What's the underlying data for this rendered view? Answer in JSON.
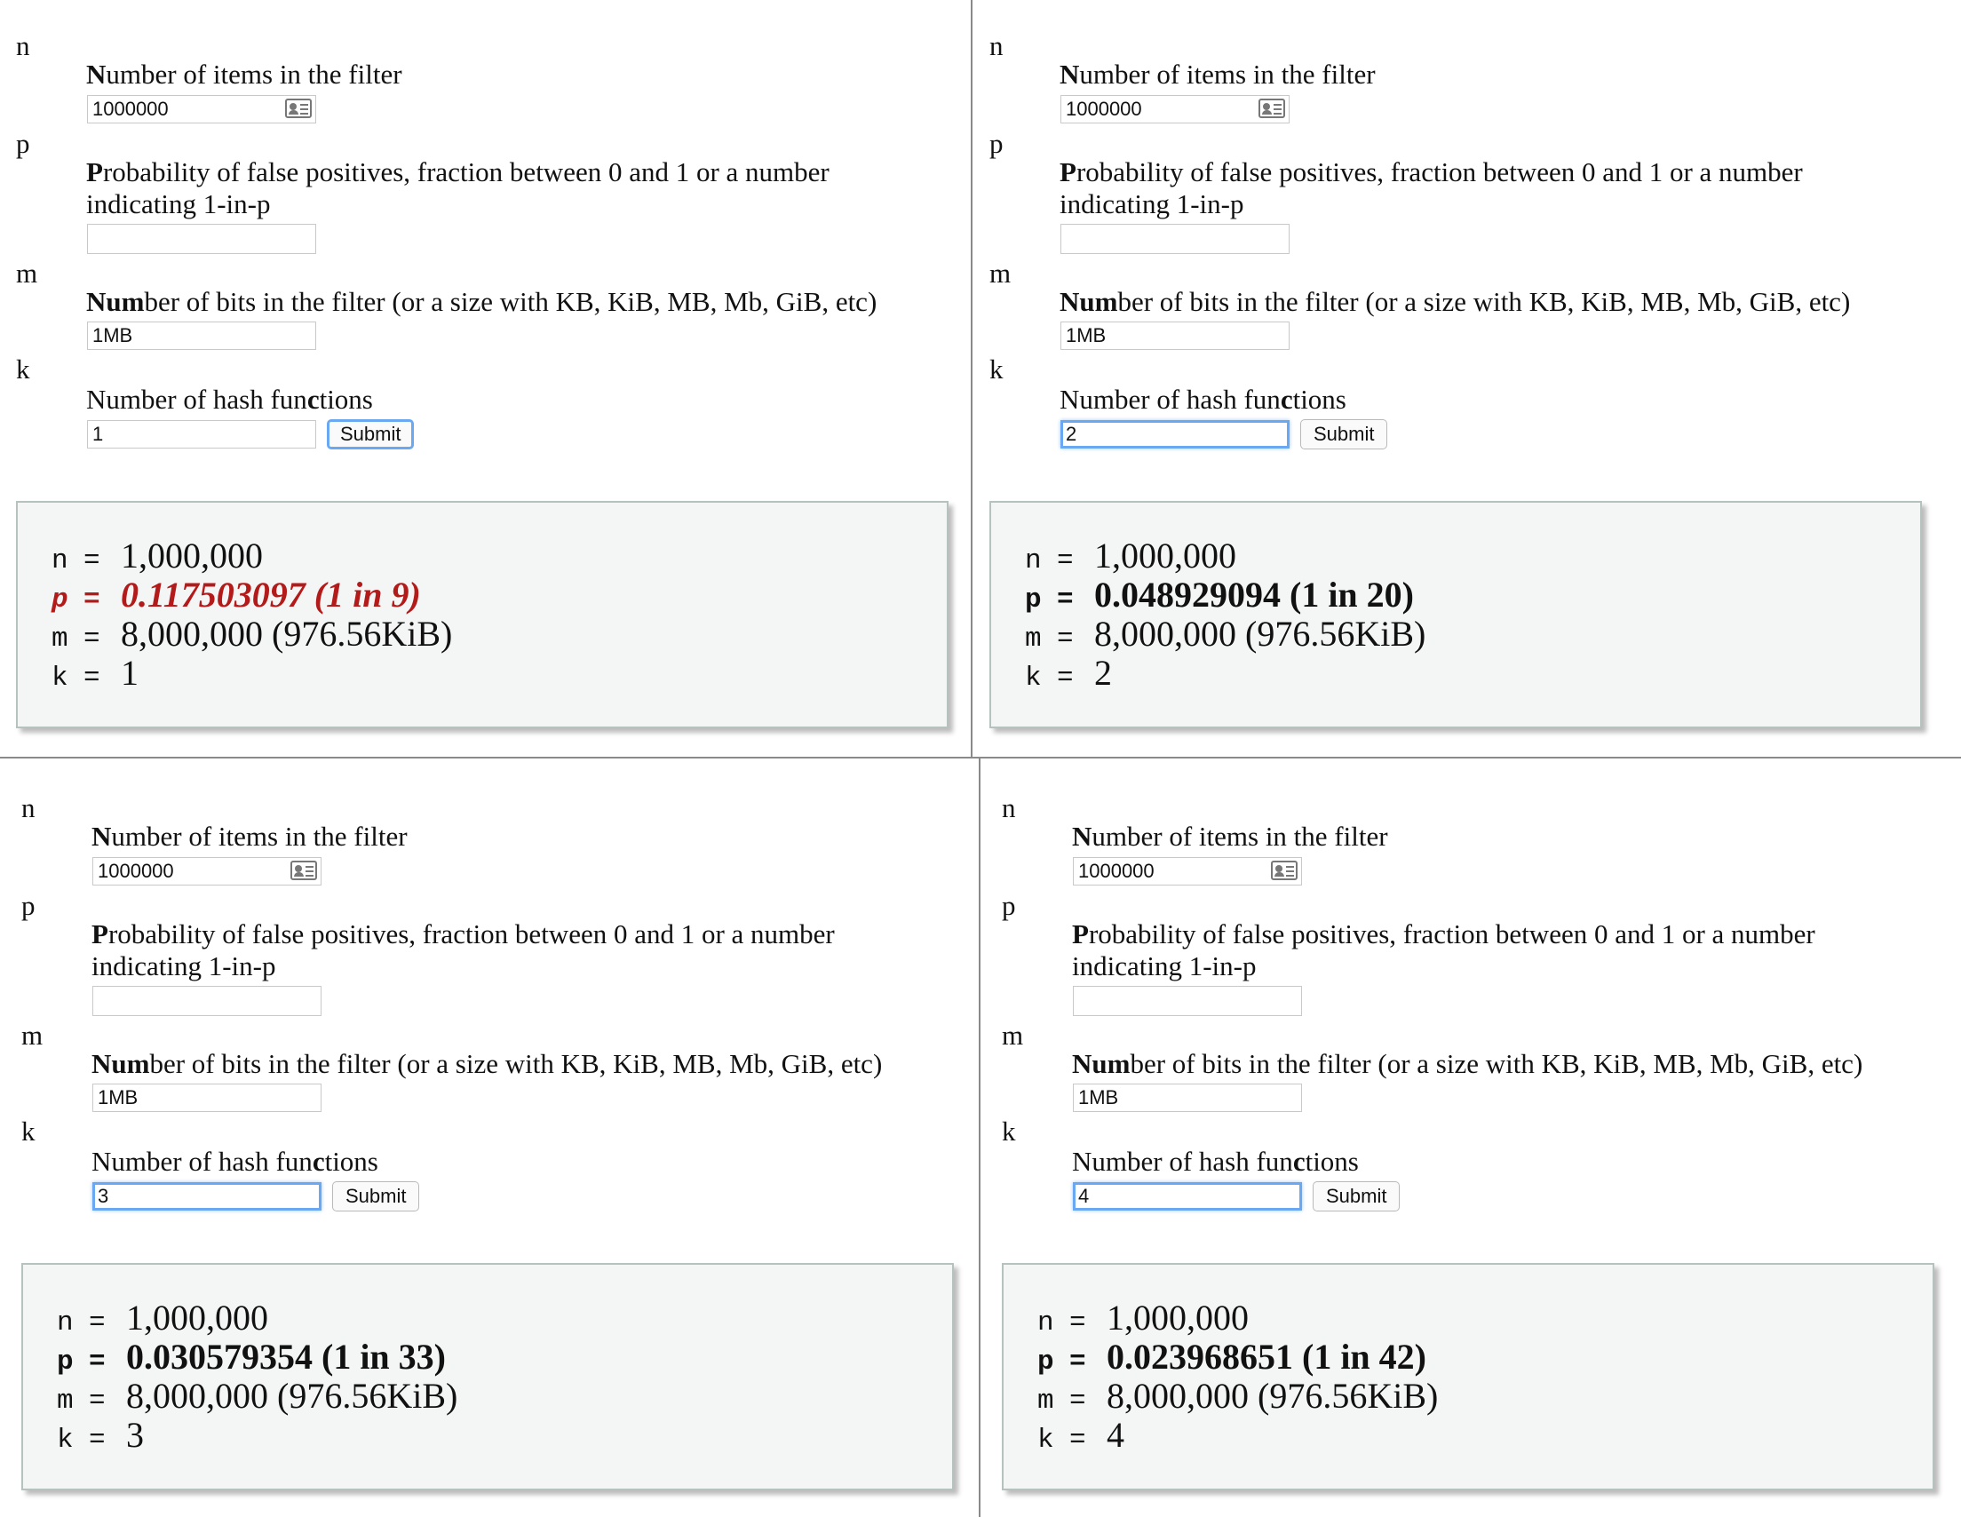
{
  "form": {
    "n_letter": "n",
    "p_letter": "p",
    "m_letter": "m",
    "k_letter": "k",
    "n_label_lead": "N",
    "n_label": "umber of items in the filter",
    "p_label_lead": "P",
    "p_label": "robability of false positives, fraction between 0 and 1 or a number indicating 1-in-p",
    "m_label_lead": "Num",
    "m_label": "ber of bits in the filter (or a size with KB, KiB, MB, Mb, GiB, etc)",
    "k_label_pre": "Number of hash fun",
    "k_label_lead": "c",
    "k_label": "tions",
    "submit_label": "Submit"
  },
  "panels": [
    {
      "n_value": "1000000",
      "p_value": "",
      "m_value": "1MB",
      "k_value": "1",
      "k_focused": false,
      "submit_focused": true,
      "p_error": true,
      "result": {
        "n": "1,000,000",
        "p": "0.117503097 (1 in 9)",
        "m": "8,000,000 (976.56KiB)",
        "k": "1"
      }
    },
    {
      "n_value": "1000000",
      "p_value": "",
      "m_value": "1MB",
      "k_value": "2",
      "k_focused": true,
      "submit_focused": false,
      "p_error": false,
      "result": {
        "n": "1,000,000",
        "p": "0.048929094 (1 in 20)",
        "m": "8,000,000 (976.56KiB)",
        "k": "2"
      }
    },
    {
      "n_value": "1000000",
      "p_value": "",
      "m_value": "1MB",
      "k_value": "3",
      "k_focused": true,
      "submit_focused": false,
      "p_error": false,
      "result": {
        "n": "1,000,000",
        "p": "0.030579354 (1 in 33)",
        "m": "8,000,000 (976.56KiB)",
        "k": "3"
      }
    },
    {
      "n_value": "1000000",
      "p_value": "",
      "m_value": "1MB",
      "k_value": "4",
      "k_focused": true,
      "submit_focused": false,
      "p_error": false,
      "result": {
        "n": "1,000,000",
        "p": "0.023968651 (1 in 42)",
        "m": "8,000,000 (976.56KiB)",
        "k": "4"
      }
    }
  ],
  "result_keys": {
    "n": "n",
    "p": "p",
    "m": "m",
    "k": "k",
    "eq": "="
  },
  "colors": {
    "error": "#b31b1b",
    "focus": "#6aa9f2",
    "result_bg": "#f4f6f5"
  },
  "icons": {
    "autofill": "contact-card-icon"
  }
}
